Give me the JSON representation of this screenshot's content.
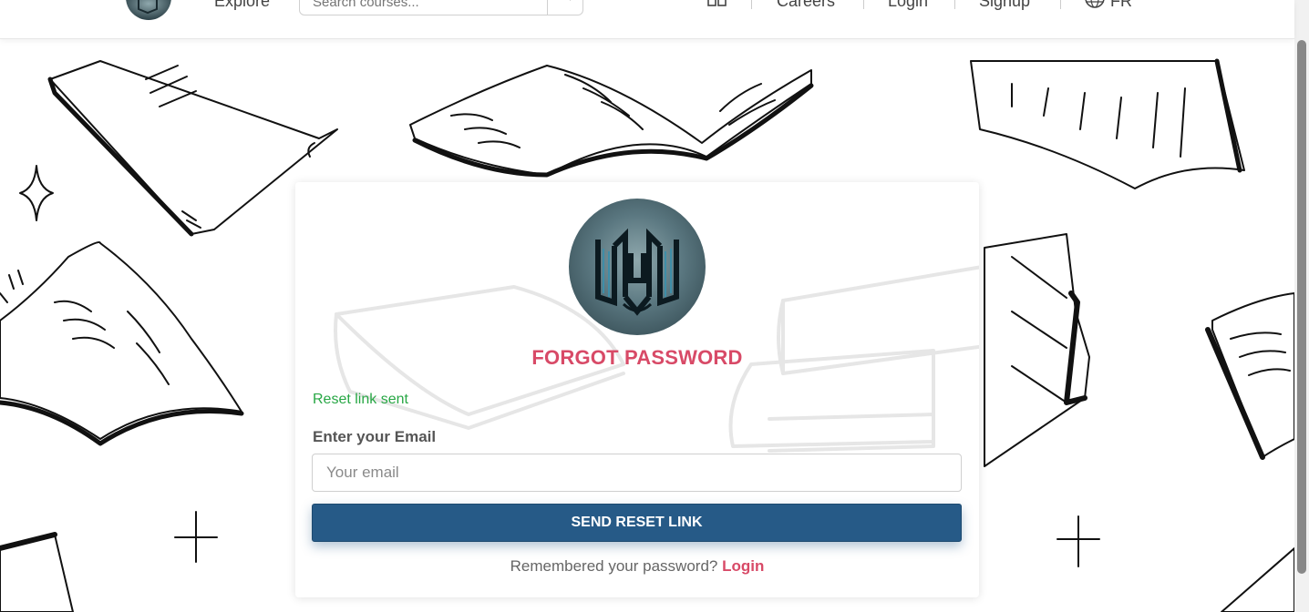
{
  "header": {
    "explore_label": "Explore",
    "search_placeholder": "Search courses...",
    "careers_label": "Careers",
    "login_label": "Login",
    "signup_label": "Signup",
    "language_label": "FR"
  },
  "form": {
    "title": "FORGOT PASSWORD",
    "success_message": "Reset link sent",
    "email_label": "Enter your Email",
    "email_placeholder": "Your email",
    "email_value": "",
    "submit_label": "SEND RESET LINK",
    "remember_text": "Remembered your password?",
    "login_link": "Login"
  },
  "colors": {
    "accent": "#d84a67",
    "primary_button": "#265a87",
    "success": "#28a745"
  },
  "icons": [
    "logo-icon",
    "search-icon",
    "grid-icon",
    "globe-icon"
  ]
}
